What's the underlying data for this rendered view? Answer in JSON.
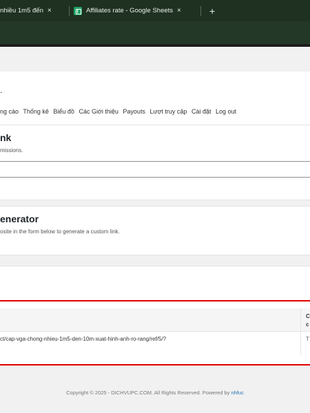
{
  "browser": {
    "tabs": [
      {
        "label": "nhiều 1m5 đến",
        "close": "×"
      },
      {
        "label": "Affiliates rate - Google Sheets",
        "close": "×"
      }
    ],
    "new_tab": "+"
  },
  "page": {
    "header_dot": ".",
    "nav": [
      "ng cáo",
      "Thống kê",
      "Biểu đồ",
      "Các Giới thiệu",
      "Payouts",
      "Lượt truy cập",
      "Cài đặt",
      "Log out"
    ],
    "affiliate_link": {
      "title": "nk",
      "desc": "missions."
    },
    "generator": {
      "title": "enerator",
      "desc": "osite in the form below to generate a custom link."
    },
    "result": {
      "col_header": "C\nc",
      "url": "ct/cap-vga-chong-nhieu-1m5-den-10m-xuat-hinh-anh-ro-rang/ref/5/?",
      "cell": "T"
    },
    "footer": {
      "text": "Copyright © 2025 - DICHVUPC.COM. All Rights Reserved. Powered by",
      "link": "nhfuc"
    }
  }
}
